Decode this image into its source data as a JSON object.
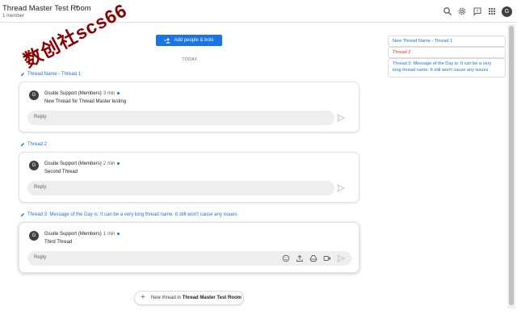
{
  "header": {
    "room_title": "Thread Master Test Room",
    "member_count": "1 member",
    "avatar_letter": "G",
    "icons": [
      "search-icon",
      "settings-icon",
      "feedback-icon",
      "apps-grid-icon",
      "account-avatar"
    ]
  },
  "main": {
    "add_people_label": "Add people & bots",
    "date_divider": "TODAY",
    "threads": [
      {
        "title": "Thread Name - Thread 1",
        "sender": "Gsuite Support (Members)",
        "time": "3 min",
        "message": "New Thread for Thread Master testing",
        "reply_placeholder": "Reply",
        "avatar_letter": "G"
      },
      {
        "title": "Thread 2",
        "sender": "Gsuite Support (Members)",
        "time": "2 min",
        "message": "Second Thread",
        "reply_placeholder": "Reply",
        "avatar_letter": "G"
      },
      {
        "title": "Thread 3: Message of the Day is: It can be a very long thread name. It still won't cause any issues",
        "sender": "Gsuite Support (Members)",
        "time": "1 min",
        "message": "Third Thread",
        "reply_placeholder": "Reply",
        "avatar_letter": "G"
      }
    ],
    "new_thread_prefix": "New thread in",
    "new_thread_room": "Thread Master Test Room"
  },
  "right_panel": {
    "items": [
      {
        "label": "New Thread Name - Thread 1",
        "color": "#1a73e8"
      },
      {
        "label": "Thread 2",
        "color": "#d93025"
      },
      {
        "label": "Thread 3: Message of the Day is: It can be a very long thread name. It still won't cause any issues",
        "color": "#1a73e8"
      }
    ]
  },
  "watermark": {
    "text": "数创社scs66"
  },
  "colors": {
    "accent": "#1a73e8",
    "active_thread": "#d93025",
    "watermark": "#8b0000"
  }
}
